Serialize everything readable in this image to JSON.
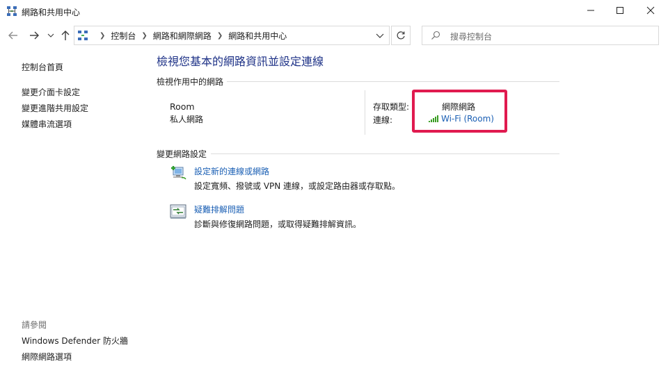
{
  "window": {
    "title": "網路和共用中心",
    "icon": "network-center-icon"
  },
  "nav": {
    "breadcrumbs": [
      "控制台",
      "網路和網際網路",
      "網路和共用中心"
    ],
    "search_placeholder": "搜尋控制台"
  },
  "sidebar": {
    "home_label": "控制台首頁",
    "items": [
      {
        "label": "變更介面卡設定"
      },
      {
        "label": "變更進階共用設定"
      },
      {
        "label": "媒體串流選項"
      }
    ],
    "see_also_label": "請參閱",
    "see_also": [
      {
        "label": "Windows Defender 防火牆"
      },
      {
        "label": "網際網路選項"
      }
    ]
  },
  "main": {
    "heading": "檢視您基本的網路資訊並設定連線",
    "active_section_label": "檢視作用中的網路",
    "network": {
      "name": "Room",
      "category": "私人網路",
      "access_type_label": "存取類型:",
      "access_type_value": "網際網路",
      "connection_label": "連線:",
      "connection_value": "Wi-Fi (Room)"
    },
    "change_section_label": "變更網路設定",
    "tasks": [
      {
        "title": "設定新的連線或網路",
        "desc": "設定寬頻、撥號或 VPN 連線，或設定路由器或存取點。",
        "icon": "new-connection-icon"
      },
      {
        "title": "疑難排解問題",
        "desc": "診斷與修復網路問題，或取得疑難排解資訊。",
        "icon": "troubleshoot-icon"
      }
    ]
  },
  "colors": {
    "heading": "#1e3287",
    "link": "#1a5fb4",
    "highlight": "#e01a4f",
    "wifi_bars": "#3a9d23"
  }
}
